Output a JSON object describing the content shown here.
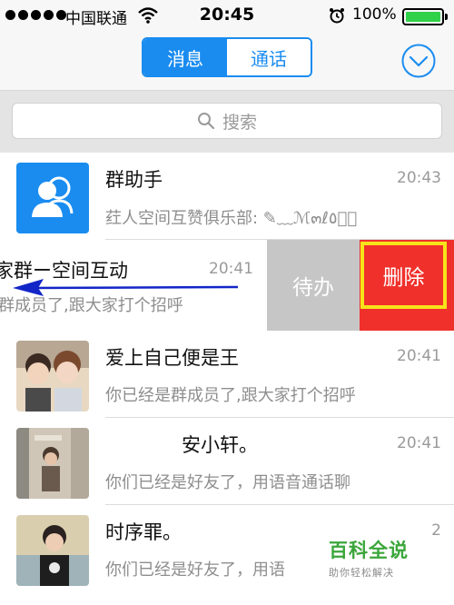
{
  "status_bar": {
    "carrier": "中国联通",
    "time": "20:45",
    "battery": "100%"
  },
  "navbar": {
    "tabs": [
      {
        "label": "消息",
        "active": true
      },
      {
        "label": "通话",
        "active": false
      }
    ],
    "menu_icon": "chevron-down-circle-icon"
  },
  "search": {
    "placeholder": "搜索"
  },
  "conversations": [
    {
      "name": "群助手",
      "time": "20:43",
      "message": "荭人空间互赞俱乐部: ✎﹏ℳ๓ℓ٥ۣۜ",
      "avatar": "group-assistant-icon"
    },
    {
      "name": "家群ー空间互动",
      "time": "20:41",
      "message": "群成员了,跟大家打个招呼",
      "swiped": true
    },
    {
      "name": "爱上自己便是王",
      "time": "20:41",
      "message": "你已经是群成员了,跟大家打个招呼"
    },
    {
      "name": "安小轩。",
      "time": "20:41",
      "message": "你们已经是好友了，用语音通话聊"
    },
    {
      "name": "时序罪。",
      "time": "2",
      "message": "你们已经是好友了，用语"
    }
  ],
  "swipe_actions": {
    "todo_label": "待办",
    "delete_label": "删除"
  },
  "watermark": {
    "title": "百科全说",
    "subtitle": "助你轻松解决"
  },
  "colors": {
    "accent": "#1a8cf0",
    "delete": "#f0302b",
    "todo": "#c6c6c6",
    "highlight_box": "#f7e31a",
    "arrow": "#1226c8"
  }
}
